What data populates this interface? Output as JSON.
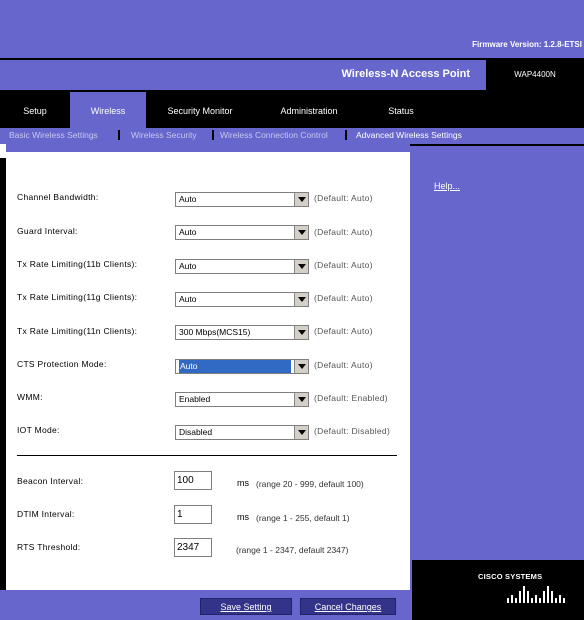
{
  "header": {
    "firmware": "Firmware Version: 1.2.8-ETSI",
    "product": "Wireless-N Access Point",
    "model": "WAP4400N"
  },
  "tabs": [
    {
      "label": "Setup"
    },
    {
      "label": "Wireless",
      "active": true
    },
    {
      "label": "Security Monitor"
    },
    {
      "label": "Administration"
    },
    {
      "label": "Status"
    }
  ],
  "subtabs": [
    {
      "label": "Basic Wireless Settings"
    },
    {
      "label": "Wireless Security"
    },
    {
      "label": "Wireless Connection Control"
    },
    {
      "label": "Advanced Wireless Settings",
      "active": true
    }
  ],
  "help": "Help...",
  "settings": [
    {
      "label": "Channel Bandwidth:",
      "value": "Auto",
      "default": "(Default: Auto)"
    },
    {
      "label": "Guard Interval:",
      "value": "Auto",
      "default": "(Default: Auto)"
    },
    {
      "label": "Tx Rate Limiting(11b Clients):",
      "value": "Auto",
      "default": "(Default: Auto)"
    },
    {
      "label": "Tx Rate Limiting(11g Clients):",
      "value": "Auto",
      "default": "(Default: Auto)"
    },
    {
      "label": "Tx Rate Limiting(11n Clients):",
      "value": "300 Mbps(MCS15)",
      "default": "(Default: Auto)"
    },
    {
      "label": "CTS Protection Mode:",
      "value": "Auto",
      "default": "(Default: Auto)"
    },
    {
      "label": "WMM:",
      "value": "Enabled",
      "default": "(Default: Enabled)"
    },
    {
      "label": "IOT Mode:",
      "value": "Disabled",
      "default": "(Default: Disabled)"
    }
  ],
  "intervals": [
    {
      "label": "Beacon Interval:",
      "value": "100",
      "unit": "ms",
      "range": "(range 20 - 999, default 100)"
    },
    {
      "label": "DTIM Interval:",
      "value": "1",
      "unit": "ms",
      "range": "(range 1 - 255, default 1)"
    },
    {
      "label": "RTS Threshold:",
      "value": "2347",
      "unit": "",
      "range": "(range 1 - 2347, default 2347)"
    }
  ],
  "buttons": {
    "save": "Save Setting",
    "cancel": "Cancel Changes"
  },
  "brand": {
    "logo_text": "CISCO SYSTEMS",
    "accent": "#6666cc",
    "highlight": "#316ac5"
  }
}
